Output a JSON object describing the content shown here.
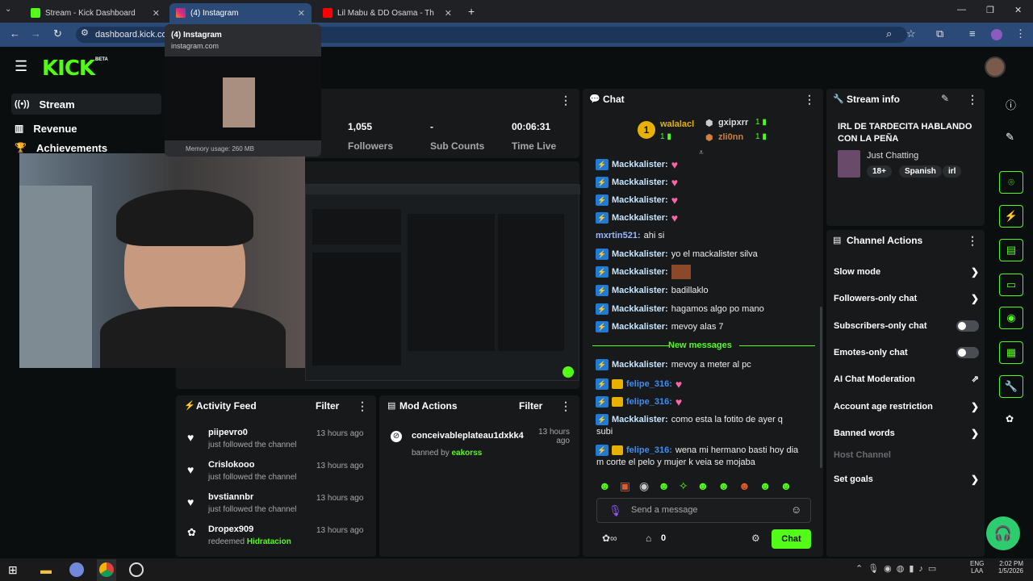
{
  "browser": {
    "tabs": [
      {
        "label": "Stream - Kick Dashboard",
        "active": false
      },
      {
        "label": "(4) Instagram",
        "active": true
      },
      {
        "label": "Lil Mabu & DD Osama - Th",
        "active": false
      }
    ],
    "url": "dashboard.kick.co",
    "hover_card": {
      "title": "(4) Instagram",
      "domain": "instagram.com",
      "memory": "Memory usage: 260 MB"
    }
  },
  "kick": {
    "logo": "KICK",
    "beta": "BETA",
    "sidebar": [
      {
        "label": "Stream",
        "icon": "broadcast-icon",
        "selected": true
      },
      {
        "label": "Revenue",
        "icon": "chart-icon",
        "selected": false
      },
      {
        "label": "Achievements",
        "icon": "trophy-icon",
        "selected": false
      }
    ],
    "stats": [
      {
        "value": "1,055",
        "label": "Followers"
      },
      {
        "value": "-",
        "label": "Sub Counts"
      },
      {
        "value": "00:06:31",
        "label": "Time Live"
      }
    ]
  },
  "chat": {
    "title": "Chat",
    "top_gifters": [
      {
        "rank": "1",
        "name": "walalacl",
        "count": "1"
      },
      {
        "name": "gxipxrr",
        "count": "1"
      },
      {
        "name": "zli0nn",
        "count": "1"
      }
    ],
    "messages": [
      {
        "user": "Mackkalister:",
        "text": "",
        "heart": true
      },
      {
        "user": "Mackkalister:",
        "text": "",
        "heart": true
      },
      {
        "user": "Mackkalister:",
        "text": "",
        "heart": true
      },
      {
        "user": "Mackkalister:",
        "text": "",
        "heart": true
      },
      {
        "user": "mxrtin521:",
        "text": "ahi si",
        "heart": false
      },
      {
        "user": "Mackkalister:",
        "text": "yo el mackalister silva",
        "heart": false
      },
      {
        "user": "Mackkalister:",
        "text": "",
        "heart": false
      },
      {
        "user": "Mackkalister:",
        "text": "badillaklo",
        "heart": false
      },
      {
        "user": "Mackkalister:",
        "text": "hagamos algo po mano",
        "heart": false
      },
      {
        "user": "Mackkalister:",
        "text": "mevoy alas 7",
        "heart": false
      }
    ],
    "new_messages_label": "New messages",
    "messages2": [
      {
        "user": "Mackkalister:",
        "text": "mevoy a meter al pc"
      },
      {
        "user": "felipe_316:",
        "text": ""
      },
      {
        "user": "felipe_316:",
        "text": ""
      },
      {
        "user": "Mackkalister:",
        "text": "como esta la fotito de ayer q"
      },
      {
        "user": "felipe_316:",
        "text": "wena mi hermano basti hoy dia"
      }
    ],
    "wrap_1": "subi",
    "wrap_2": "m corte el pelo y mujer k veia se mojaba",
    "input_placeholder": "Send a message",
    "points": "0",
    "send_label": "Chat"
  },
  "stream_info": {
    "title": "Stream info",
    "stream_title": "IRL DE TARDECITA HABLANDO CON LA PEÑA",
    "category": "Just Chatting",
    "tags": [
      "18+",
      "Spanish",
      "irl"
    ]
  },
  "channel_actions": {
    "title": "Channel Actions",
    "items": [
      {
        "label": "Slow mode",
        "kind": "arrow"
      },
      {
        "label": "Followers-only chat",
        "kind": "arrow"
      },
      {
        "label": "Subscribers-only chat",
        "kind": "toggle"
      },
      {
        "label": "Emotes-only chat",
        "kind": "toggle"
      },
      {
        "label": "AI Chat Moderation",
        "kind": "external"
      },
      {
        "label": "Account age restriction",
        "kind": "arrow"
      },
      {
        "label": "Banned words",
        "kind": "arrow"
      },
      {
        "label": "Host Channel",
        "kind": "disabled"
      },
      {
        "label": "Set goals",
        "kind": "arrow"
      }
    ]
  },
  "activity_feed": {
    "title": "Activity Feed",
    "filter": "Filter",
    "items": [
      {
        "user": "piipevro0",
        "action": "just followed the channel",
        "time": "13 hours ago"
      },
      {
        "user": "Crislokooo",
        "action": "just followed the channel",
        "time": "13 hours ago"
      },
      {
        "user": "bvstiannbr",
        "action": "just followed the channel",
        "time": "13 hours ago"
      },
      {
        "user": "Dropex909",
        "action": "redeemed",
        "reward": "Hidratacion",
        "time": "13 hours ago"
      }
    ]
  },
  "mod_actions": {
    "title": "Mod Actions",
    "filter": "Filter",
    "items": [
      {
        "user": "conceivableplateau1dxkk4",
        "action": "banned by",
        "by": "eakorss",
        "time": "13 hours ago"
      }
    ]
  },
  "taskbar": {
    "lang": "ENG",
    "region": "LAA",
    "time": "2:02 PM",
    "date": "1/5/2026"
  },
  "colors": {
    "accent": "#53fc18",
    "panel": "#17191b",
    "background": "#0b0e0f",
    "tab_active": "#2b4a77"
  }
}
